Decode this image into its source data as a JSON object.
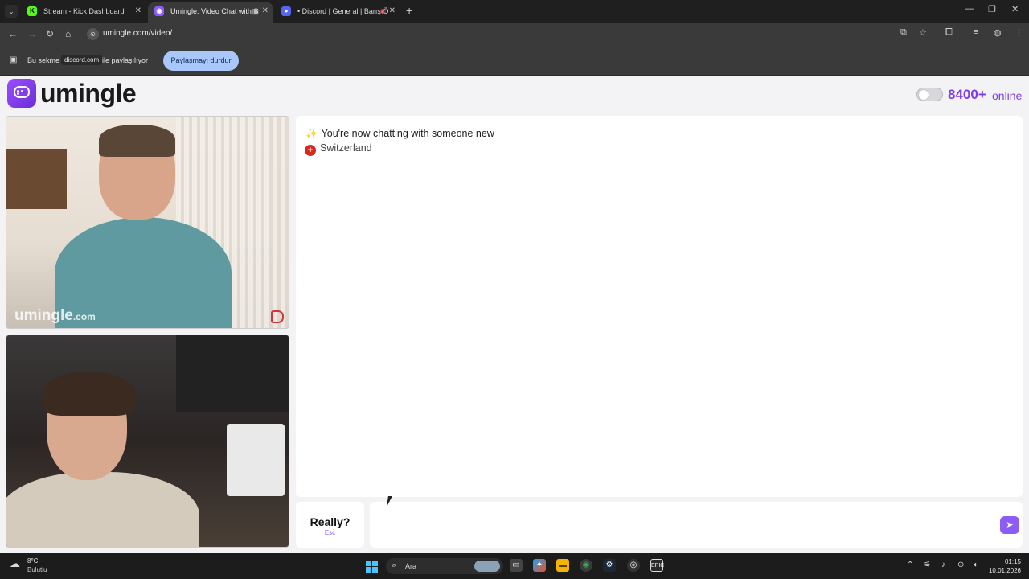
{
  "browser": {
    "tabs": [
      {
        "title": "Stream - Kick Dashboard",
        "icon": "kick-icon",
        "icon_glyph": "K",
        "active": false
      },
      {
        "title": "Umingle: Video Chat with S",
        "icon": "umingle-icon",
        "icon_glyph": "◉",
        "active": true
      },
      {
        "title": "• Discord | General | Barış Ö",
        "icon": "discord-icon",
        "icon_glyph": "●",
        "active": false
      }
    ],
    "url": "umingle.com/video/",
    "share_bar": {
      "text_before": "Bu sekme",
      "domain": "discord.com",
      "text_after": "ile paylaşılıyor",
      "stop_button": "Paylaşmayı durdur"
    }
  },
  "app": {
    "logo": "umingle",
    "online_count": "8400+",
    "online_label": "online",
    "online_toggle_on": false,
    "watermark": {
      "main": "umingle",
      "suffix": ".com"
    }
  },
  "chat": {
    "messages": [
      {
        "icon": "sparkles-icon",
        "glyph": "✨",
        "text": "You're now chatting with someone new"
      },
      {
        "icon": "switzerland-flag-icon",
        "glyph": "+",
        "text": "Switzerland"
      }
    ],
    "esc_button": {
      "label": "Really?",
      "hint": "Esc"
    },
    "input_value": "",
    "send_icon": "send-icon"
  },
  "taskbar": {
    "weather_temp": "8°C",
    "weather_desc": "Bulutlu",
    "search_placeholder": "Ara",
    "time": "01:15",
    "date": "10.01.2026"
  },
  "colors": {
    "accent": "#7c3aed",
    "share_button": "#a8c7fa",
    "report": "#d6333a"
  }
}
